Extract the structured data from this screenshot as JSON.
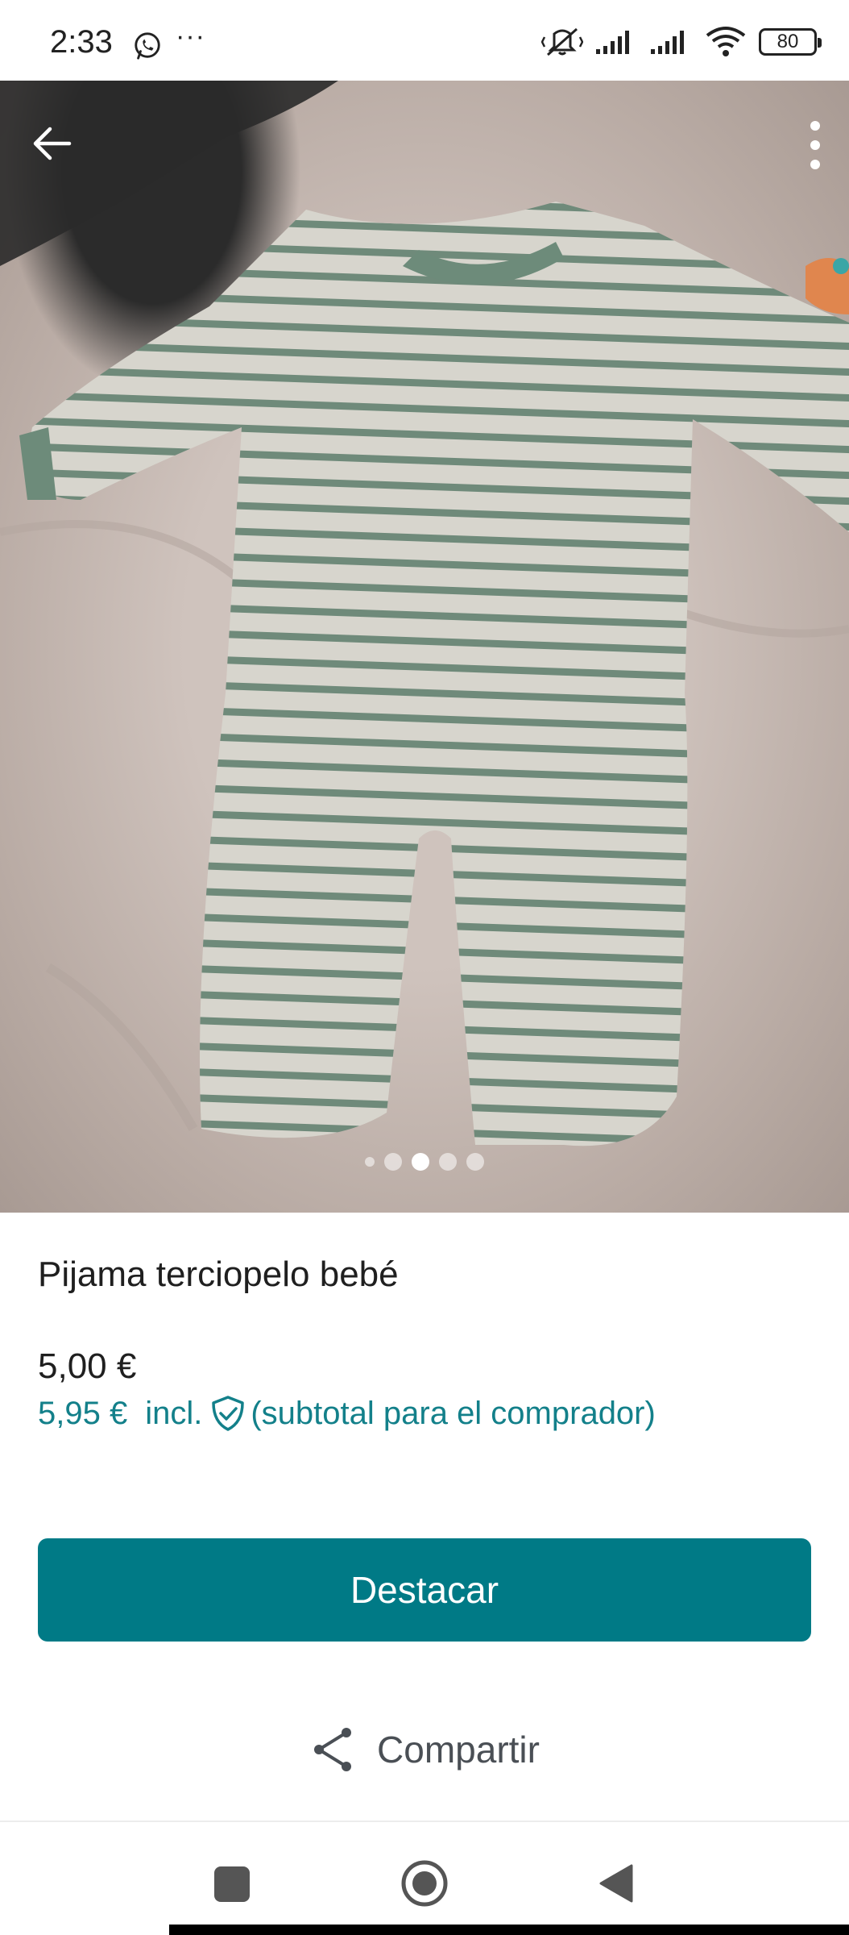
{
  "status_bar": {
    "time": "2:33",
    "notification_icons": [
      "whatsapp-icon",
      "more-notifications-icon"
    ],
    "overflow_text": "···",
    "right_icons": [
      "mute-vibrate-icon",
      "signal-icon",
      "signal-icon",
      "wifi-icon",
      "battery-icon"
    ],
    "battery_level": "80"
  },
  "photo": {
    "back_icon": "arrow-left-icon",
    "menu_icon": "more-vertical-icon",
    "image_count": 5,
    "active_index": 2
  },
  "product": {
    "title": "Pijama terciopelo bebé",
    "price": "5,00 €",
    "buyer_price": "5,95 €",
    "buyer_incl": "incl.",
    "buyer_note": "(subtotal para el comprador)",
    "protection_icon": "shield-check-icon"
  },
  "actions": {
    "highlight_label": "Destacar",
    "share_label": "Compartir",
    "share_icon": "share-icon"
  },
  "nav_bar": {
    "items": [
      "recent-apps-icon",
      "home-icon",
      "back-icon"
    ]
  },
  "colors": {
    "accent": "#007a86",
    "buyer_text": "#13808a",
    "text": "#1f1f1f"
  }
}
